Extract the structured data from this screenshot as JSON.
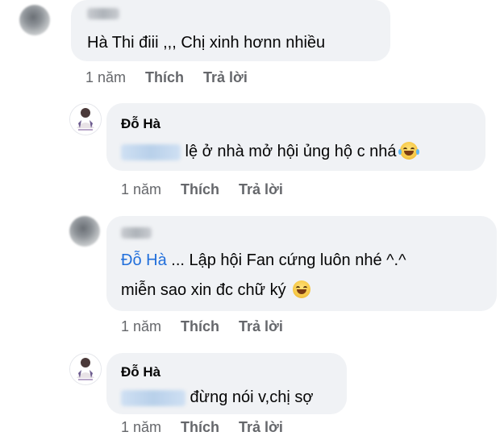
{
  "comments": [
    {
      "author": "",
      "text": "Hà Thi điii  ,,, Chị xinh hơnn nhiều",
      "time": "1 năm",
      "like": "Thích",
      "reply": "Trả lời"
    },
    {
      "author": "Đỗ Hà",
      "text": " lệ ở nhà mở hội ủng hộ c nhá",
      "emoji": "laughing-tears-emoji",
      "time": "1 năm",
      "like": "Thích",
      "reply": "Trả lời"
    },
    {
      "author": "",
      "mention": "Đỗ Hà",
      "line1": " ... Lập hội Fan cứng luôn nhé ^.^",
      "line2": "miễn sao xin đc chữ ký",
      "emoji": "grinning-emoji",
      "time": "1 năm",
      "like": "Thích",
      "reply": "Trả lời"
    },
    {
      "author": "Đỗ Hà",
      "text": " đừng nói v,chị sợ",
      "time": "1 năm",
      "like": "Thích",
      "reply": "Trả lời"
    }
  ]
}
